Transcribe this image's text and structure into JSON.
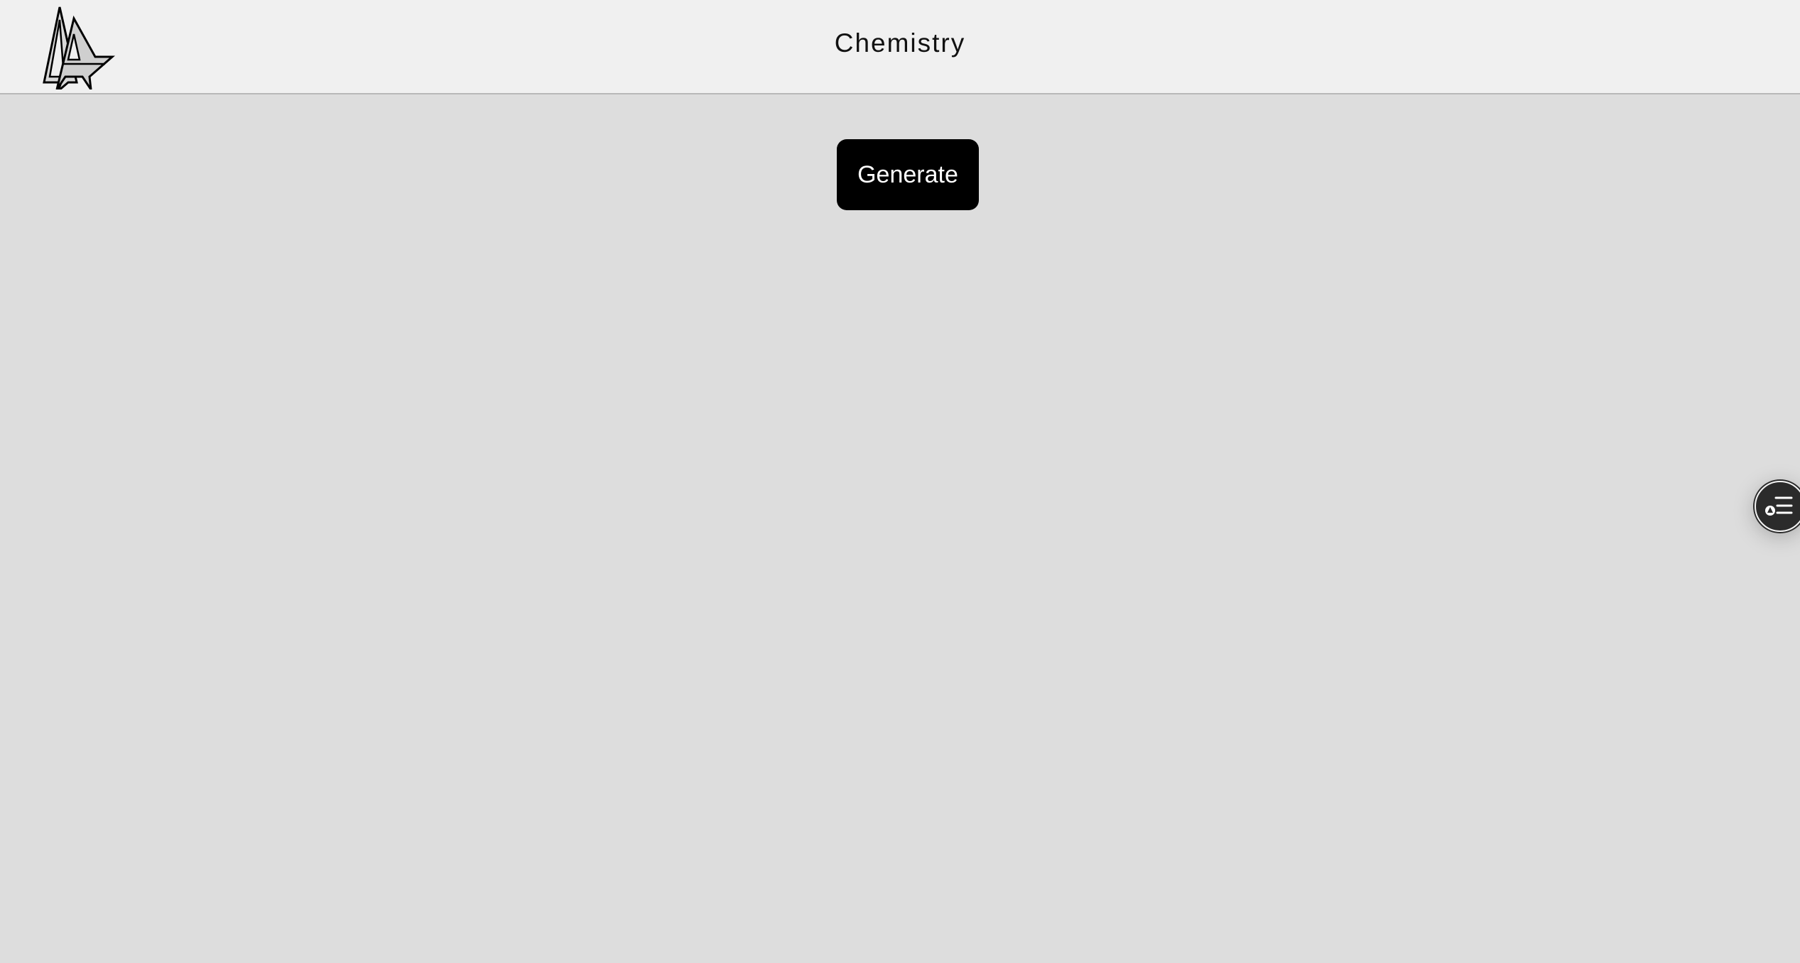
{
  "header": {
    "title": "Chemistry",
    "logo_icon": "la-monogram-logo-icon"
  },
  "main": {
    "generate_label": "Generate"
  },
  "floating_button": {
    "icon": "list-toggle-icon"
  },
  "colors": {
    "header_bg": "#f0f0f0",
    "page_bg": "#dddddd",
    "button_bg": "#000000",
    "button_text": "#ffffff",
    "floating_bg": "#2b2b2b"
  }
}
